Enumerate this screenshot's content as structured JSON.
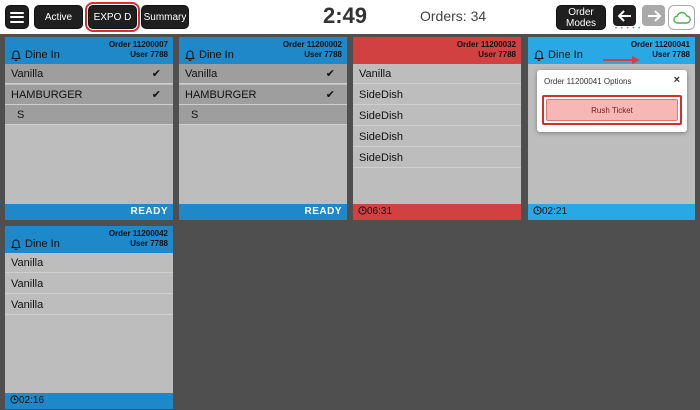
{
  "topbar": {
    "menu_icon": "hamburger-menu-icon",
    "active_label": "Active",
    "expo_label": "EXPO D",
    "summary_label": "Summary",
    "clock": "2:49",
    "orders_label": "Orders: 34",
    "order_modes_label": "Order\nModes",
    "back_icon": "arrow-left-icon",
    "forward_icon": "arrow-right-icon",
    "dots": "• • • •",
    "cloud_icon": "cloud-icon"
  },
  "colors": {
    "blue": "#1e88c9",
    "light_blue": "#29a8e6",
    "red": "#d14141",
    "card_bg": "#bdbdbd",
    "done_row": "#9e9e9e",
    "grid_bg": "#4f4f4f"
  },
  "tickets": [
    {
      "order": "Order 11200007",
      "user": "User 7788",
      "mode": "Dine In",
      "items": [
        {
          "name": "Vanilla",
          "done": true
        },
        {
          "name": "HAMBURGER",
          "done": true
        },
        {
          "name": "S",
          "modifier": true
        }
      ],
      "footer": "READY"
    },
    {
      "order": "Order 11200002",
      "user": "User 7788",
      "mode": "Dine In",
      "items": [
        {
          "name": "Vanilla",
          "done": true
        },
        {
          "name": "HAMBURGER",
          "done": true
        },
        {
          "name": "S",
          "modifier": true
        }
      ],
      "footer": "READY"
    },
    {
      "order": "Order 11200032",
      "user": "User 7788",
      "mode": "",
      "items": [
        {
          "name": "Vanilla"
        },
        {
          "name": "SideDish"
        },
        {
          "name": "SideDish"
        },
        {
          "name": "SideDish"
        },
        {
          "name": "SideDish"
        }
      ],
      "timer": "06:31"
    },
    {
      "order": "Order 11200041",
      "user": "User 7788",
      "mode": "Dine In",
      "items": [],
      "timer": "02:21"
    },
    {
      "order": "Order 11200042",
      "user": "User 7788",
      "mode": "Dine In",
      "items": [
        {
          "name": "Vanilla"
        },
        {
          "name": "Vanilla"
        },
        {
          "name": "Vanilla"
        }
      ],
      "timer": "02:16"
    }
  ],
  "popup": {
    "title": "Order 11200041 Options",
    "close": "×",
    "rush_label": "Rush Ticket"
  }
}
